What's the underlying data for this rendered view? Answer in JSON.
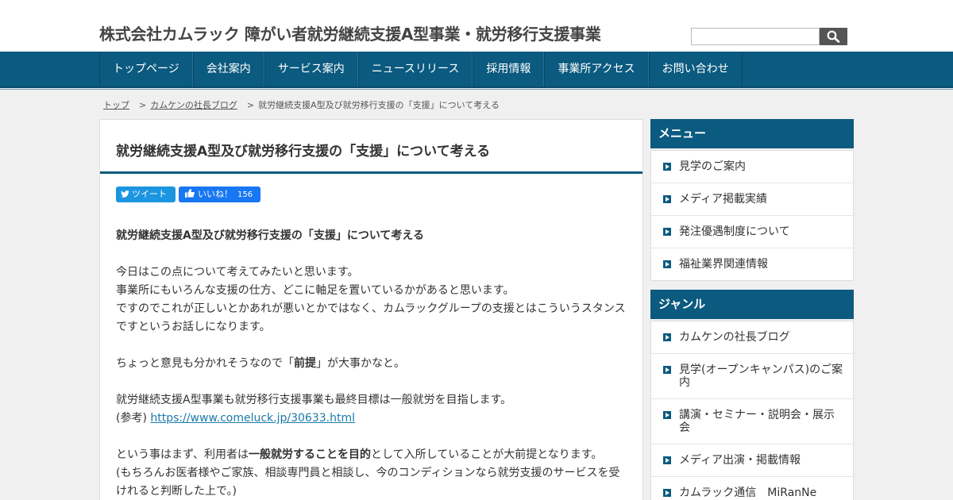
{
  "header": {
    "site_title": "株式会社カムラック 障がい者就労継続支援A型事業・就労移行支援事業",
    "search_placeholder": "",
    "search_button_icon": "search-icon"
  },
  "nav": {
    "items": [
      "トップページ",
      "会社案内",
      "サービス案内",
      "ニュースリリース",
      "採用情報",
      "事業所アクセス",
      "お問い合わせ"
    ]
  },
  "breadcrumb": {
    "home": "トップ",
    "category": "カムケンの社長ブログ",
    "current": "就労継続支援A型及び就労移行支援の「支援」について考える",
    "separator": ">"
  },
  "post": {
    "title": "就労継続支援A型及び就労移行支援の「支援」について考える",
    "share": {
      "tweet_label": "ツイート",
      "like_label": "いいね！",
      "like_count": "156"
    },
    "p1_bold": "就労継続支援A型及び就労移行支援の「支援」について考える",
    "p2_l1": "今日はこの点について考えてみたいと思います。",
    "p2_l2": "事業所にもいろんな支援の仕方、どこに軸足を置いているかがあると思います。",
    "p2_l3": "ですのでこれが正しいとかあれが悪いとかではなく、カムラックグループの支援とはこういうスタンス",
    "p2_l4": "ですというお話しになります。",
    "p3_pre": "ちょっと意見も分かれそうなので「",
    "p3_bold": "前提",
    "p3_post": "」が大事かなと。",
    "p4_l1": "就労継続支援A型事業も就労移行支援事業も最終目標は一般就労を目指します。",
    "p4_ref_label": "(参考) ",
    "p4_link": "https://www.comeluck.jp/30633.html",
    "p5_pre": "という事はまず、利用者は",
    "p5_bold": "一般就労することを目的",
    "p5_post": "として入所していることが大前提となります。",
    "p5_l2": "(もちろんお医者様やご家族、相談専門員と相談し、今のコンディションなら就労支援のサービスを受",
    "p5_l3": "けれると判断した上で。)"
  },
  "sidebar": {
    "menu_title": "メニュー",
    "menu_items": [
      "見学のご案内",
      "メディア掲載実績",
      "発注優遇制度について",
      "福祉業界関連情報"
    ],
    "genre_title": "ジャンル",
    "genre_items": [
      "カムケンの社長ブログ",
      "見学(オープンキャンパス)のご案内",
      "講演・セミナー・説明会・展示会",
      "メディア出演・掲載情報",
      "カムラック通信　MiRanNe"
    ]
  },
  "colors": {
    "brand": "#0b5a7f",
    "tweet": "#1b95e0",
    "like": "#1877f2",
    "link": "#1a7aa9"
  }
}
